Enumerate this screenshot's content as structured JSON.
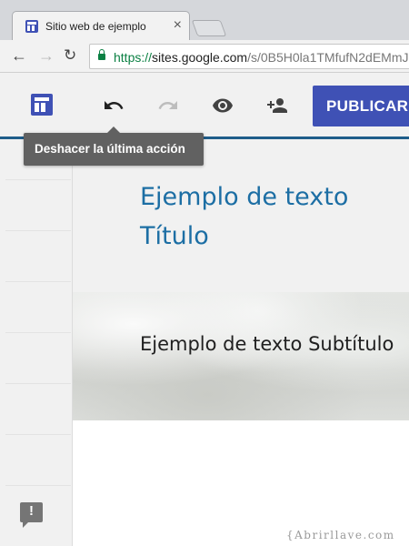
{
  "browser": {
    "tab": {
      "title": "Sitio web de ejemplo",
      "close_glyph": "×",
      "favicon": "google-sites-favicon"
    },
    "nav": {
      "back_glyph": "←",
      "forward_glyph": "→",
      "reload_glyph": "↻"
    },
    "address": {
      "scheme": "https://",
      "host": "sites.google.com",
      "path": "/s/0B5H0la1TMfufN2dEMmJ"
    }
  },
  "editor": {
    "toolbar": {
      "layout_icon": "layout-icon",
      "undo_icon": "undo-icon",
      "redo_icon": "redo-icon",
      "preview_icon": "preview-icon",
      "share_icon": "add-person-icon",
      "publish_label": "PUBLICAR"
    },
    "tooltip": "Deshacer la última acción",
    "site_title": "Ejemplo de texto Título",
    "site_subtitle": "Ejemplo de texto Subtítulo",
    "feedback_glyph": "!"
  },
  "colors": {
    "accent": "#3f51b5",
    "title_text": "#1c6ea4",
    "header_underline": "#1f5d8a",
    "tooltip_bg": "#616161"
  },
  "watermark": "{Abrirllave.com"
}
